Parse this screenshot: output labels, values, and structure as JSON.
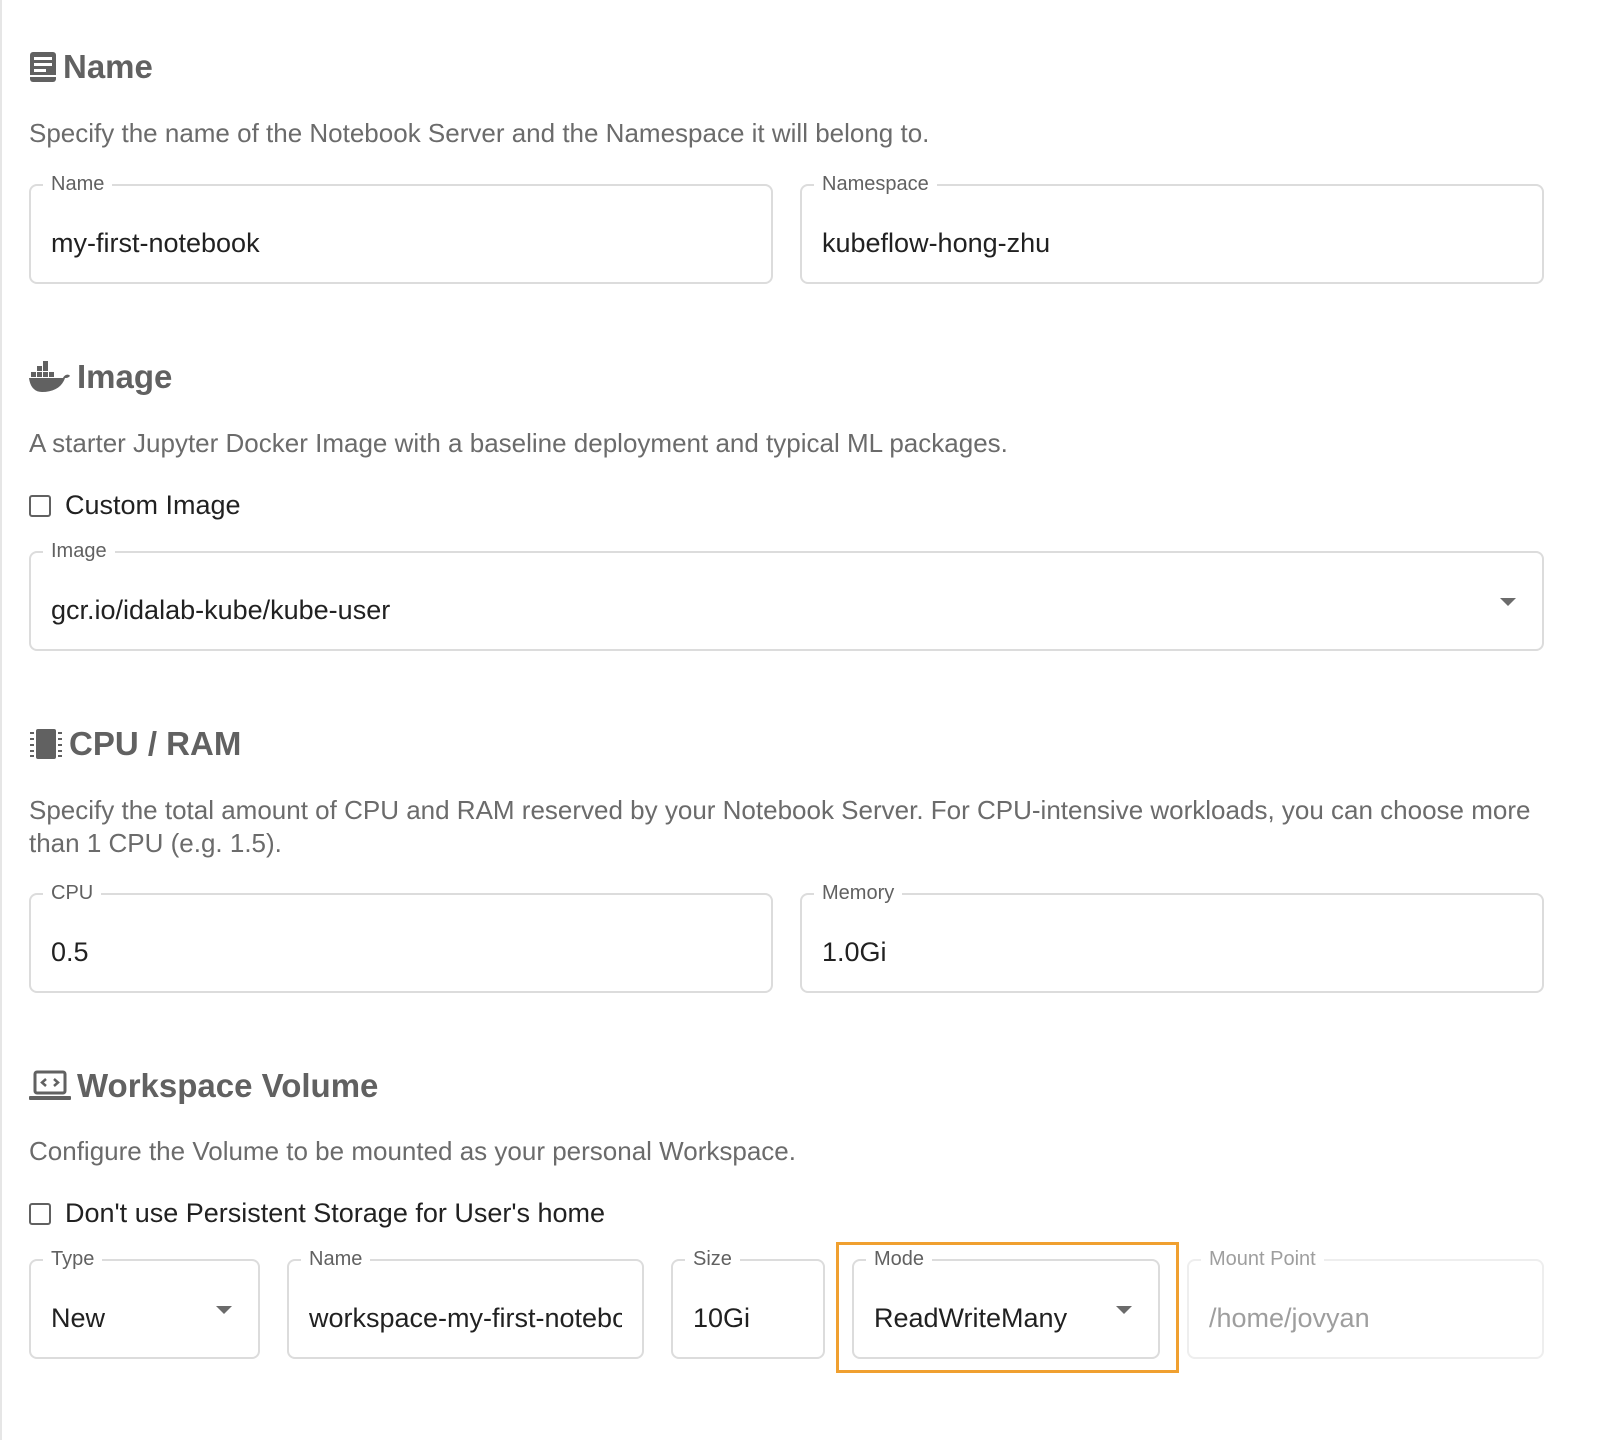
{
  "name_section": {
    "title": "Name",
    "icon": "book-icon",
    "description": "Specify the name of the Notebook Server and the Namespace it will belong to.",
    "name_field": {
      "label": "Name",
      "value": "my-first-notebook"
    },
    "namespace_field": {
      "label": "Namespace",
      "value": "kubeflow-hong-zhu"
    }
  },
  "image_section": {
    "title": "Image",
    "icon": "docker-whale-icon",
    "description": "A starter Jupyter Docker Image with a baseline deployment and typical ML packages.",
    "custom_image_label": "Custom Image",
    "custom_image_checked": false,
    "image_field": {
      "label": "Image",
      "value": "gcr.io/idalab-kube/kube-user"
    }
  },
  "cpu_section": {
    "title": "CPU / RAM",
    "icon": "memory-chip-icon",
    "description": "Specify the total amount of CPU and RAM reserved by your Notebook Server. For CPU-intensive workloads, you can choose more than 1 CPU (e.g. 1.5).",
    "cpu_field": {
      "label": "CPU",
      "value": "0.5"
    },
    "memory_field": {
      "label": "Memory",
      "value": "1.0Gi"
    }
  },
  "workspace_section": {
    "title": "Workspace Volume",
    "icon": "laptop-code-icon",
    "description": "Configure the Volume to be mounted as your personal Workspace.",
    "no_persistent_label": "Don't use Persistent Storage for User's home",
    "no_persistent_checked": false,
    "type_field": {
      "label": "Type",
      "value": "New"
    },
    "name_field": {
      "label": "Name",
      "value": "workspace-my-first-notebook"
    },
    "size_field": {
      "label": "Size",
      "value": "10Gi"
    },
    "mode_field": {
      "label": "Mode",
      "value": "ReadWriteMany"
    },
    "mount_field": {
      "label": "Mount Point",
      "value": "/home/jovyan"
    }
  },
  "colors": {
    "highlight": "#f0a030",
    "section_title": "#616161",
    "description": "#6b6b6b"
  }
}
